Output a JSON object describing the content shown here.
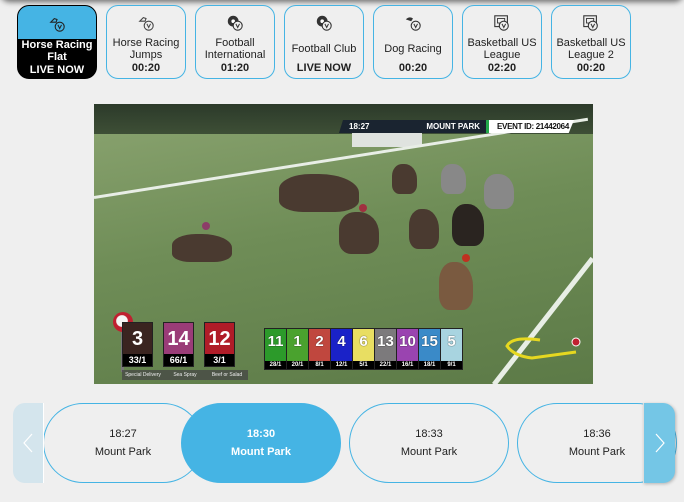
{
  "categories": [
    {
      "name": "Horse Racing Flat",
      "time": "LIVE NOW",
      "icon": "horse-racing-icon",
      "active": true
    },
    {
      "name": "Horse Racing Jumps",
      "time": "00:20",
      "icon": "horse-racing-icon",
      "active": false
    },
    {
      "name": "Football International",
      "time": "01:20",
      "icon": "football-icon",
      "active": false
    },
    {
      "name": "Football Club",
      "time": "LIVE NOW",
      "icon": "football-icon",
      "active": false
    },
    {
      "name": "Dog Racing",
      "time": "00:20",
      "icon": "dog-racing-icon",
      "active": false
    },
    {
      "name": "Basketball US League",
      "time": "02:20",
      "icon": "basketball-icon",
      "active": false
    },
    {
      "name": "Basketball US League 2",
      "time": "00:20",
      "icon": "basketball-icon",
      "active": false
    }
  ],
  "video": {
    "hud_time": "18:27",
    "hud_venue": "MOUNT PARK",
    "hud_event": "EVENT ID: 21442064",
    "top_three": [
      {
        "number": "3",
        "odds": "33/1",
        "name": "Special Delivery",
        "color": "#3a2420"
      },
      {
        "number": "14",
        "odds": "66/1",
        "name": "Sea Spray",
        "color": "#9a3c78"
      },
      {
        "number": "12",
        "odds": "3/1",
        "name": "Beef or Salad",
        "color": "#b01c28"
      }
    ],
    "runners": [
      {
        "number": "11",
        "odds": "28/1",
        "color": "#2c9a2a"
      },
      {
        "number": "1",
        "odds": "20/1",
        "color": "#4aa22e"
      },
      {
        "number": "2",
        "odds": "8/1",
        "color": "#c0473e"
      },
      {
        "number": "4",
        "odds": "12/1",
        "color": "#1a22c8"
      },
      {
        "number": "6",
        "odds": "5/1",
        "color": "#e8de62"
      },
      {
        "number": "13",
        "odds": "22/1",
        "color": "#7c7a7c"
      },
      {
        "number": "10",
        "odds": "16/1",
        "color": "#9a44b0"
      },
      {
        "number": "15",
        "odds": "18/1",
        "color": "#3a8ac8"
      },
      {
        "number": "5",
        "odds": "9/1",
        "color": "#a8d4e0"
      }
    ]
  },
  "races": [
    {
      "time": "18:27",
      "venue": "Mount Park",
      "active": false
    },
    {
      "time": "18:30",
      "venue": "Mount Park",
      "active": true
    },
    {
      "time": "18:33",
      "venue": "Mount Park",
      "active": false
    },
    {
      "time": "18:36",
      "venue": "Mount Park",
      "active": false
    }
  ],
  "colors": {
    "accent": "#45b4e4",
    "background": "#efefef"
  }
}
